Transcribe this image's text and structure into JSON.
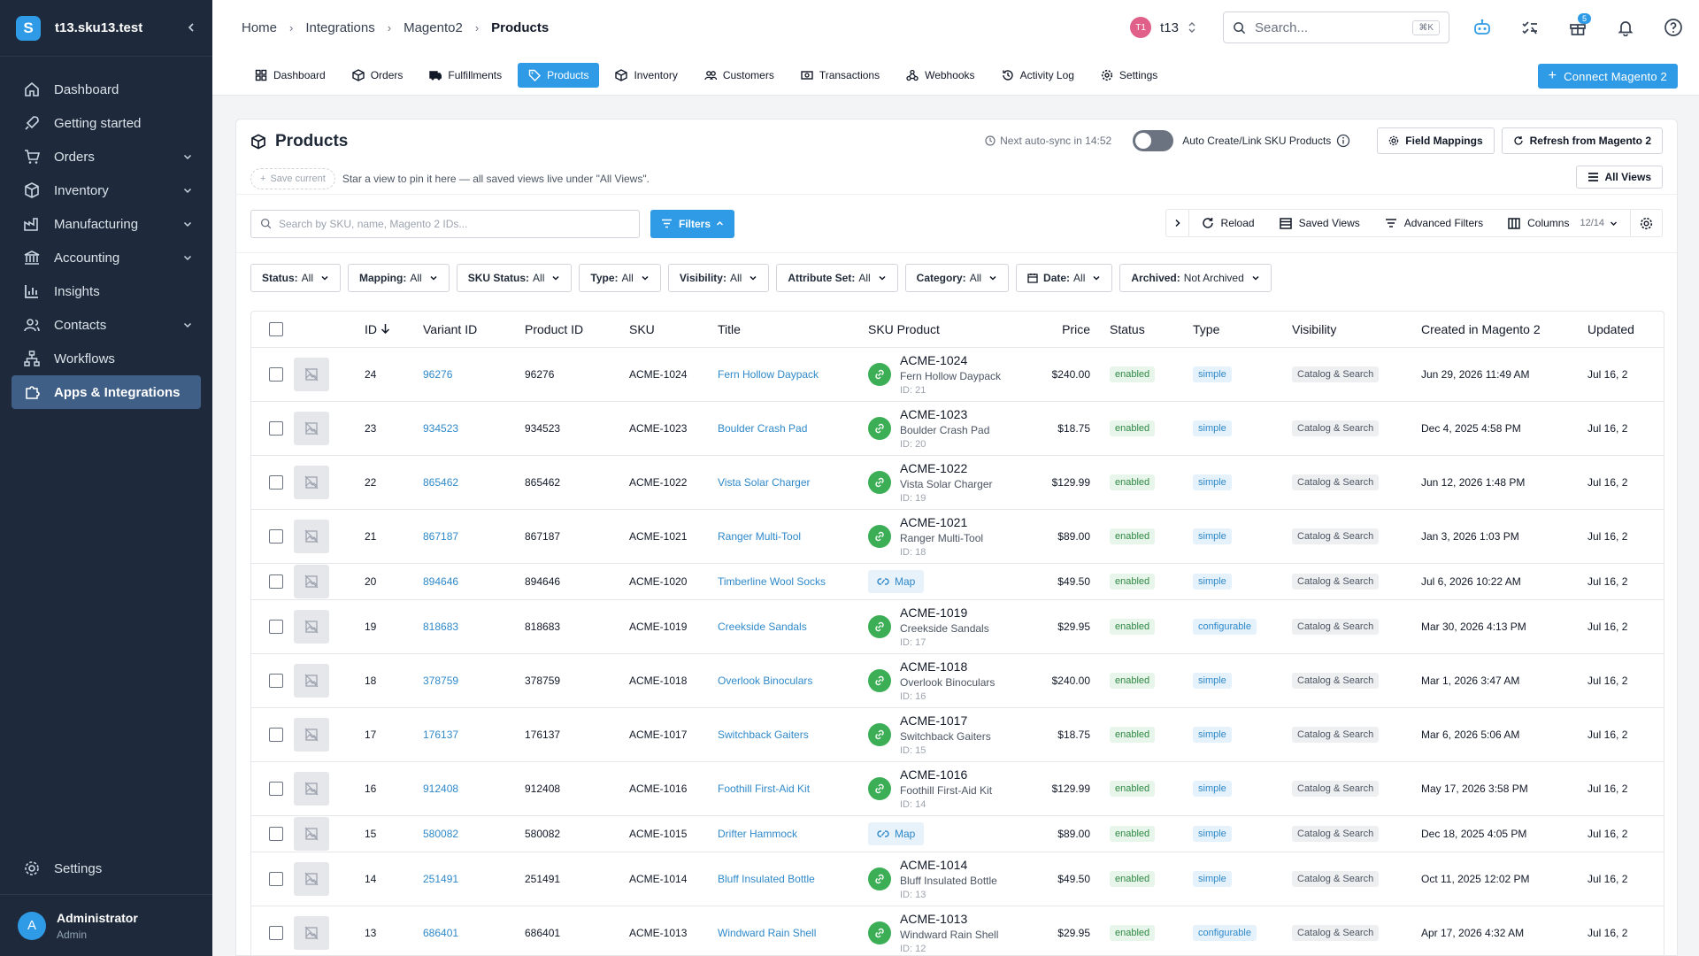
{
  "sidebar": {
    "title": "t13.sku13.test",
    "logo_letter": "S",
    "items": [
      {
        "label": "Dashboard",
        "icon": "home-icon",
        "chevron": false,
        "active": false
      },
      {
        "label": "Getting started",
        "icon": "rocket-icon",
        "chevron": false,
        "active": false
      },
      {
        "label": "Orders",
        "icon": "cart-icon",
        "chevron": true,
        "active": false
      },
      {
        "label": "Inventory",
        "icon": "box-icon",
        "chevron": true,
        "active": false
      },
      {
        "label": "Manufacturing",
        "icon": "factory-icon",
        "chevron": true,
        "active": false
      },
      {
        "label": "Accounting",
        "icon": "bank-icon",
        "chevron": true,
        "active": false
      },
      {
        "label": "Insights",
        "icon": "chart-icon",
        "chevron": false,
        "active": false
      },
      {
        "label": "Contacts",
        "icon": "contacts-icon",
        "chevron": true,
        "active": false
      },
      {
        "label": "Workflows",
        "icon": "workflow-icon",
        "chevron": false,
        "active": false
      },
      {
        "label": "Apps & Integrations",
        "icon": "puzzle-icon",
        "chevron": false,
        "active": true
      }
    ],
    "settings_label": "Settings",
    "user": {
      "initial": "A",
      "name": "Administrator",
      "role": "Admin"
    }
  },
  "topbar": {
    "breadcrumbs": [
      "Home",
      "Integrations",
      "Magento2",
      "Products"
    ],
    "tenant_badge": "T1",
    "tenant_name": "t13",
    "search_placeholder": "Search...",
    "search_shortcut": "⌘K",
    "gift_badge": "5"
  },
  "tabs": [
    {
      "label": "Dashboard",
      "icon": "dashboard-icon",
      "active": false
    },
    {
      "label": "Orders",
      "icon": "box-icon",
      "active": false
    },
    {
      "label": "Fulfillments",
      "icon": "truck-icon",
      "active": false
    },
    {
      "label": "Products",
      "icon": "tag-icon",
      "active": true
    },
    {
      "label": "Inventory",
      "icon": "box-icon",
      "active": false
    },
    {
      "label": "Customers",
      "icon": "users-icon",
      "active": false
    },
    {
      "label": "Transactions",
      "icon": "money-icon",
      "active": false
    },
    {
      "label": "Webhooks",
      "icon": "webhook-icon",
      "active": false
    },
    {
      "label": "Activity Log",
      "icon": "history-icon",
      "active": false
    },
    {
      "label": "Settings",
      "icon": "gear-icon",
      "active": false
    }
  ],
  "connect_label": "Connect Magento 2",
  "card": {
    "title": "Products",
    "sync_text": "Next auto-sync in 14:52",
    "auto_label": "Auto Create/Link SKU Products",
    "field_mappings": "Field Mappings",
    "refresh": "Refresh from Magento 2",
    "save_current": "Save current",
    "saved_hint": "Star a view to pin it here — all saved views live under \"All Views\".",
    "all_views": "All Views"
  },
  "toolbar": {
    "search_placeholder": "Search by SKU, name, Magento 2 IDs...",
    "filters": "Filters",
    "reload": "Reload",
    "saved_views": "Saved Views",
    "advanced_filters": "Advanced Filters",
    "columns": "Columns",
    "columns_count": "12/14"
  },
  "chips": [
    {
      "label": "Status:",
      "value": "All"
    },
    {
      "label": "Mapping:",
      "value": "All"
    },
    {
      "label": "SKU Status:",
      "value": "All"
    },
    {
      "label": "Type:",
      "value": "All"
    },
    {
      "label": "Visibility:",
      "value": "All"
    },
    {
      "label": "Attribute Set:",
      "value": "All"
    },
    {
      "label": "Category:",
      "value": "All"
    },
    {
      "label": "Date:",
      "value": "All"
    },
    {
      "label": "Archived:",
      "value": "Not Archived"
    }
  ],
  "table": {
    "headers": [
      "ID",
      "Variant ID",
      "Product ID",
      "SKU",
      "Title",
      "SKU Product",
      "Price",
      "Status",
      "Type",
      "Visibility",
      "Created in Magento 2",
      "Updated"
    ],
    "map_label": "Map",
    "rows": [
      {
        "id": "24",
        "variant": "96276",
        "product": "96276",
        "sku": "ACME-1024",
        "title": "Fern Hollow Daypack",
        "mapped": true,
        "sp_sku": "ACME-1024",
        "sp_name": "Fern Hollow Daypack",
        "sp_id": "ID: 21",
        "price": "$240.00",
        "status": "enabled",
        "type": "simple",
        "visibility": "Catalog & Search",
        "created": "Jun 29, 2026 11:49 AM",
        "updated": "Jul 16, 2"
      },
      {
        "id": "23",
        "variant": "934523",
        "product": "934523",
        "sku": "ACME-1023",
        "title": "Boulder Crash Pad",
        "mapped": true,
        "sp_sku": "ACME-1023",
        "sp_name": "Boulder Crash Pad",
        "sp_id": "ID: 20",
        "price": "$18.75",
        "status": "enabled",
        "type": "simple",
        "visibility": "Catalog & Search",
        "created": "Dec 4, 2025 4:58 PM",
        "updated": "Jul 16, 2"
      },
      {
        "id": "22",
        "variant": "865462",
        "product": "865462",
        "sku": "ACME-1022",
        "title": "Vista Solar Charger",
        "mapped": true,
        "sp_sku": "ACME-1022",
        "sp_name": "Vista Solar Charger",
        "sp_id": "ID: 19",
        "price": "$129.99",
        "status": "enabled",
        "type": "simple",
        "visibility": "Catalog & Search",
        "created": "Jun 12, 2026 1:48 PM",
        "updated": "Jul 16, 2"
      },
      {
        "id": "21",
        "variant": "867187",
        "product": "867187",
        "sku": "ACME-1021",
        "title": "Ranger Multi-Tool",
        "mapped": true,
        "sp_sku": "ACME-1021",
        "sp_name": "Ranger Multi-Tool",
        "sp_id": "ID: 18",
        "price": "$89.00",
        "status": "enabled",
        "type": "simple",
        "visibility": "Catalog & Search",
        "created": "Jan 3, 2026 1:03 PM",
        "updated": "Jul 16, 2"
      },
      {
        "id": "20",
        "variant": "894646",
        "product": "894646",
        "sku": "ACME-1020",
        "title": "Timberline Wool Socks",
        "mapped": false,
        "price": "$49.50",
        "status": "enabled",
        "type": "simple",
        "visibility": "Catalog & Search",
        "created": "Jul 6, 2026 10:22 AM",
        "updated": "Jul 16, 2"
      },
      {
        "id": "19",
        "variant": "818683",
        "product": "818683",
        "sku": "ACME-1019",
        "title": "Creekside Sandals",
        "mapped": true,
        "sp_sku": "ACME-1019",
        "sp_name": "Creekside Sandals",
        "sp_id": "ID: 17",
        "price": "$29.95",
        "status": "enabled",
        "type": "configurable",
        "visibility": "Catalog & Search",
        "created": "Mar 30, 2026 4:13 PM",
        "updated": "Jul 16, 2"
      },
      {
        "id": "18",
        "variant": "378759",
        "product": "378759",
        "sku": "ACME-1018",
        "title": "Overlook Binoculars",
        "mapped": true,
        "sp_sku": "ACME-1018",
        "sp_name": "Overlook Binoculars",
        "sp_id": "ID: 16",
        "price": "$240.00",
        "status": "enabled",
        "type": "simple",
        "visibility": "Catalog & Search",
        "created": "Mar 1, 2026 3:47 AM",
        "updated": "Jul 16, 2"
      },
      {
        "id": "17",
        "variant": "176137",
        "product": "176137",
        "sku": "ACME-1017",
        "title": "Switchback Gaiters",
        "mapped": true,
        "sp_sku": "ACME-1017",
        "sp_name": "Switchback Gaiters",
        "sp_id": "ID: 15",
        "price": "$18.75",
        "status": "enabled",
        "type": "simple",
        "visibility": "Catalog & Search",
        "created": "Mar 6, 2026 5:06 AM",
        "updated": "Jul 16, 2"
      },
      {
        "id": "16",
        "variant": "912408",
        "product": "912408",
        "sku": "ACME-1016",
        "title": "Foothill First-Aid Kit",
        "mapped": true,
        "sp_sku": "ACME-1016",
        "sp_name": "Foothill First-Aid Kit",
        "sp_id": "ID: 14",
        "price": "$129.99",
        "status": "enabled",
        "type": "simple",
        "visibility": "Catalog & Search",
        "created": "May 17, 2026 3:58 PM",
        "updated": "Jul 16, 2"
      },
      {
        "id": "15",
        "variant": "580082",
        "product": "580082",
        "sku": "ACME-1015",
        "title": "Drifter Hammock",
        "mapped": false,
        "price": "$89.00",
        "status": "enabled",
        "type": "simple",
        "visibility": "Catalog & Search",
        "created": "Dec 18, 2025 4:05 PM",
        "updated": "Jul 16, 2"
      },
      {
        "id": "14",
        "variant": "251491",
        "product": "251491",
        "sku": "ACME-1014",
        "title": "Bluff Insulated Bottle",
        "mapped": true,
        "sp_sku": "ACME-1014",
        "sp_name": "Bluff Insulated Bottle",
        "sp_id": "ID: 13",
        "price": "$49.50",
        "status": "enabled",
        "type": "simple",
        "visibility": "Catalog & Search",
        "created": "Oct 11, 2025 12:02 PM",
        "updated": "Jul 16, 2"
      },
      {
        "id": "13",
        "variant": "686401",
        "product": "686401",
        "sku": "ACME-1013",
        "title": "Windward Rain Shell",
        "mapped": true,
        "sp_sku": "ACME-1013",
        "sp_name": "Windward Rain Shell",
        "sp_id": "ID: 12",
        "price": "$29.95",
        "status": "enabled",
        "type": "configurable",
        "visibility": "Catalog & Search",
        "created": "Apr 17, 2026 4:32 AM",
        "updated": "Jul 16, 2"
      }
    ]
  },
  "colors": {
    "sidebar_bg": "#1e2a3b",
    "accent": "#2f9be6",
    "active_nav": "#3f5f86",
    "mapped_green": "#3cae55"
  }
}
